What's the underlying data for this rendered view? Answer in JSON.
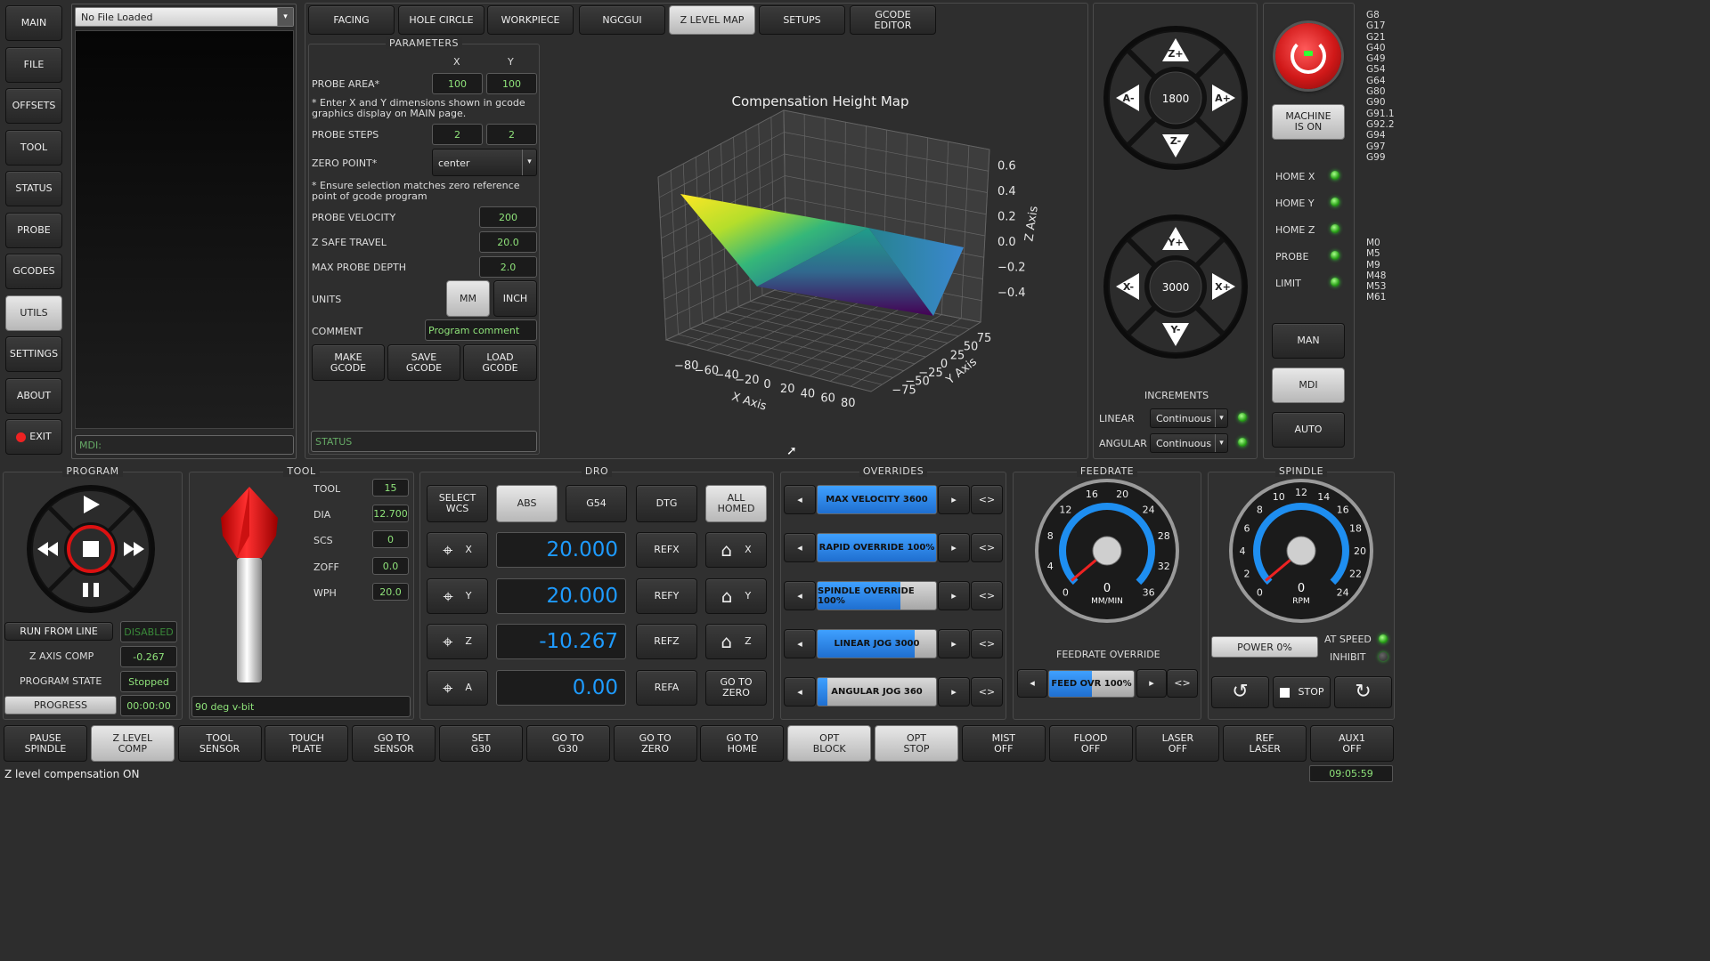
{
  "nav": {
    "items": [
      "MAIN",
      "FILE",
      "OFFSETS",
      "TOOL",
      "STATUS",
      "PROBE",
      "GCODES",
      "UTILS",
      "SETTINGS",
      "ABOUT",
      "EXIT"
    ],
    "active": "UTILS"
  },
  "file": {
    "selected": "No File Loaded",
    "mdi_placeholder": "MDI:"
  },
  "tabs": {
    "items": [
      "FACING",
      "HOLE CIRCLE",
      "WORKPIECE",
      "NGCGUI",
      "Z LEVEL MAP",
      "SETUPS",
      "GCODE\nEDITOR"
    ],
    "active": "Z LEVEL MAP"
  },
  "params": {
    "title": "PARAMETERS",
    "x_header": "X",
    "y_header": "Y",
    "probe_area_label": "PROBE AREA*",
    "probe_area_x": "100",
    "probe_area_y": "100",
    "note1": "* Enter X and Y dimensions shown in gcode graphics display on MAIN page.",
    "probe_steps_label": "PROBE STEPS",
    "probe_steps_x": "2",
    "probe_steps_y": "2",
    "zero_point_label": "ZERO POINT*",
    "zero_point_value": "center",
    "note2": "* Ensure selection matches zero reference point of gcode program",
    "probe_velocity_label": "PROBE VELOCITY",
    "probe_velocity": "200",
    "z_safe_label": "Z SAFE TRAVEL",
    "z_safe": "20.0",
    "max_depth_label": "MAX PROBE DEPTH",
    "max_depth": "2.0",
    "units_label": "UNITS",
    "units_mm": "MM",
    "units_inch": "INCH",
    "units_selected": "MM",
    "comment_label": "COMMENT",
    "comment_value": "Program comment",
    "make_gcode": "MAKE\nGCODE",
    "save_gcode": "SAVE\nGCODE",
    "load_gcode": "LOAD\nGCODE",
    "status_placeholder": "STATUS"
  },
  "chart_data": {
    "type": "surface3d",
    "title": "Compensation Height Map",
    "xlabel": "X Axis",
    "ylabel": "Y Axis",
    "zlabel": "Z Axis",
    "x_ticks": [
      -80,
      -60,
      -40,
      -20,
      0,
      20,
      40,
      60,
      80
    ],
    "y_ticks": [
      -75,
      -50,
      -25,
      0,
      25,
      50,
      75
    ],
    "z_ticks": [
      -0.4,
      -0.2,
      0.0,
      0.2,
      0.4,
      0.6
    ],
    "xlim": [
      -100,
      100
    ],
    "ylim": [
      -100,
      100
    ],
    "zlim": [
      -0.5,
      0.7
    ],
    "colormap": "viridis",
    "grid": true
  },
  "jog": {
    "z_rate": "1800",
    "xy_rate": "3000",
    "z_plus": "Z+",
    "z_minus": "Z-",
    "a_plus": "A+",
    "a_minus": "A-",
    "x_plus": "X+",
    "x_minus": "X-",
    "y_plus": "Y+",
    "y_minus": "Y-",
    "increments_title": "INCREMENTS",
    "linear_label": "LINEAR",
    "linear_value": "Continuous",
    "angular_label": "ANGULAR",
    "angular_value": "Continuous"
  },
  "machine": {
    "state": "MACHINE\nIS ON",
    "home_x": "HOME X",
    "home_y": "HOME Y",
    "home_z": "HOME Z",
    "probe": "PROBE",
    "limit": "LIMIT",
    "man": "MAN",
    "mdi": "MDI",
    "auto": "AUTO"
  },
  "gcodes_active": [
    "G8",
    "G17",
    "G21",
    "G40",
    "G49",
    "G54",
    "G64",
    "G80",
    "G90",
    "G91.1",
    "G92.2",
    "G94",
    "G97",
    "G99"
  ],
  "mcodes_active": [
    "M0",
    "M5",
    "M9",
    "M48",
    "M53",
    "M61"
  ],
  "program": {
    "title": "PROGRAM",
    "run_from_line": "RUN FROM LINE",
    "run_from_line_value": "DISABLED",
    "z_axis_comp": "Z AXIS COMP",
    "z_axis_comp_value": "-0.267",
    "program_state": "PROGRAM STATE",
    "program_state_value": "Stopped",
    "progress_label": "PROGRESS",
    "elapsed": "00:00:00"
  },
  "tool": {
    "title": "TOOL",
    "tool_label": "TOOL",
    "tool": "15",
    "dia_label": "DIA",
    "dia": "12.700",
    "scs_label": "SCS",
    "scs": "0",
    "zoff_label": "ZOFF",
    "zoff": "0.0",
    "wph_label": "WPH",
    "wph": "20.0",
    "description": "90 deg v-bit"
  },
  "dro": {
    "title": "DRO",
    "select_wcs": "SELECT\nWCS",
    "abs": "ABS",
    "g54": "G54",
    "dtg": "DTG",
    "all_homed": "ALL\nHOMED",
    "axes": [
      {
        "name": "X",
        "value": "20.000",
        "ref": "REFX"
      },
      {
        "name": "Y",
        "value": "20.000",
        "ref": "REFY"
      },
      {
        "name": "Z",
        "value": "-10.267",
        "ref": "REFZ"
      },
      {
        "name": "A",
        "value": "0.00",
        "ref": "REFA"
      }
    ],
    "go_to_zero": "GO TO\nZERO"
  },
  "overrides": {
    "title": "OVERRIDES",
    "items": [
      {
        "label": "MAX VELOCITY 3600",
        "level": 1.0
      },
      {
        "label": "RAPID OVERRIDE 100%",
        "level": 1.0
      },
      {
        "label": "SPINDLE  OVERRIDE 100%",
        "level": 0.7
      },
      {
        "label": "LINEAR JOG 3000",
        "level": 0.82
      },
      {
        "label": "ANGULAR JOG 360",
        "level": 0.08
      }
    ],
    "swap": "<>"
  },
  "feedrate": {
    "title": "FEEDRATE",
    "gauge_value": "0",
    "gauge_unit": "MM/MIN",
    "ticks": [
      "0",
      "4",
      "8",
      "12",
      "16",
      "20",
      "24",
      "28",
      "32",
      "36"
    ],
    "override_title": "FEEDRATE OVERRIDE",
    "override_label": "FEED OVR 100%",
    "override_level": 0.5
  },
  "spindle": {
    "title": "SPINDLE",
    "gauge_value": "0",
    "gauge_unit": "RPM",
    "ticks": [
      "0",
      "2",
      "4",
      "6",
      "8",
      "10",
      "12",
      "14",
      "16",
      "18",
      "20",
      "22",
      "24"
    ],
    "power": "POWER 0%",
    "at_speed": "AT SPEED",
    "inhibit": "INHIBIT",
    "stop": "STOP"
  },
  "bottom_buttons": [
    "PAUSE\nSPINDLE",
    "Z LEVEL\nCOMP",
    "TOOL\nSENSOR",
    "TOUCH\nPLATE",
    "GO TO\nSENSOR",
    "SET\nG30",
    "GO TO\nG30",
    "GO TO\nZERO",
    "GO TO\nHOME",
    "OPT\nBLOCK",
    "OPT\nSTOP",
    "MIST\nOFF",
    "FLOOD\nOFF",
    "LASER\nOFF",
    "REF\nLASER",
    "AUX1\nOFF"
  ],
  "bottom_active": [
    "Z LEVEL\nCOMP",
    "OPT\nBLOCK",
    "OPT\nSTOP"
  ],
  "status": {
    "message": "Z level compensation ON",
    "clock": "09:05:59"
  },
  "colors": {
    "accent_blue": "#1e9bff",
    "green_text": "#8fe37a",
    "estop_red": "#e02020"
  }
}
